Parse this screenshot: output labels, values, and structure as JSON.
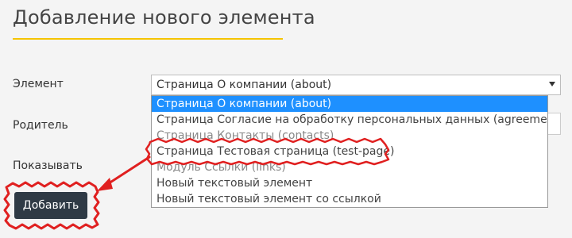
{
  "page": {
    "title": "Добавление нового элемента"
  },
  "form": {
    "element_label": "Элемент",
    "parent_label": "Родитель",
    "show_label": "Показывать",
    "selected_value": "Страница О компании (about)",
    "submit_label": "Добавить"
  },
  "dropdown": {
    "options": [
      "Страница О компании (about)",
      "Страница Согласие на обработку персональных данных (agreement)",
      "Страница Контакты (contacts)",
      "Страница Тестовая страница (test-page)",
      "Модуль Ссылки (links)",
      "Новый текстовый элемент",
      "Новый текстовый элемент со ссылкой"
    ],
    "selected_index": 0,
    "highlighted_index": 3
  },
  "colors": {
    "accent": "#f5c400",
    "selected_option": "#1e90ff",
    "annotation": "#e02020",
    "button": "#2f3a45"
  }
}
